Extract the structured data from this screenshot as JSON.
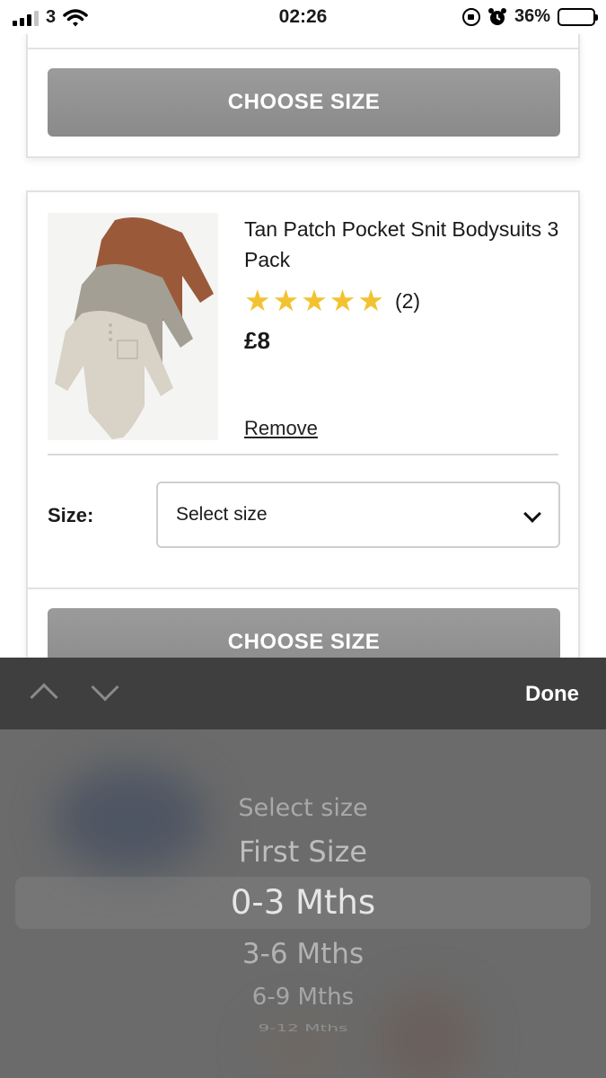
{
  "status_bar": {
    "carrier": "3",
    "time": "02:26",
    "battery": "36%"
  },
  "card1": {
    "button_label": "CHOOSE SIZE"
  },
  "product": {
    "title": "Tan Patch Pocket Snit Bodysuits 3 Pack",
    "rating_stars": 5,
    "review_count": "(2)",
    "price": "£8",
    "remove_label": "Remove",
    "size_label": "Size:",
    "size_select_value": "Select size",
    "button_label": "CHOOSE SIZE",
    "image_colors": [
      "#9a5a3a",
      "#a39f95",
      "#d8d2c7"
    ]
  },
  "accessory_bar": {
    "done_label": "Done"
  },
  "picker": {
    "options": [
      "Select size",
      "First Size",
      "0-3 Mths",
      "3-6 Mths",
      "6-9 Mths",
      "9-12 Mths"
    ],
    "selected": "0-3 Mths"
  }
}
